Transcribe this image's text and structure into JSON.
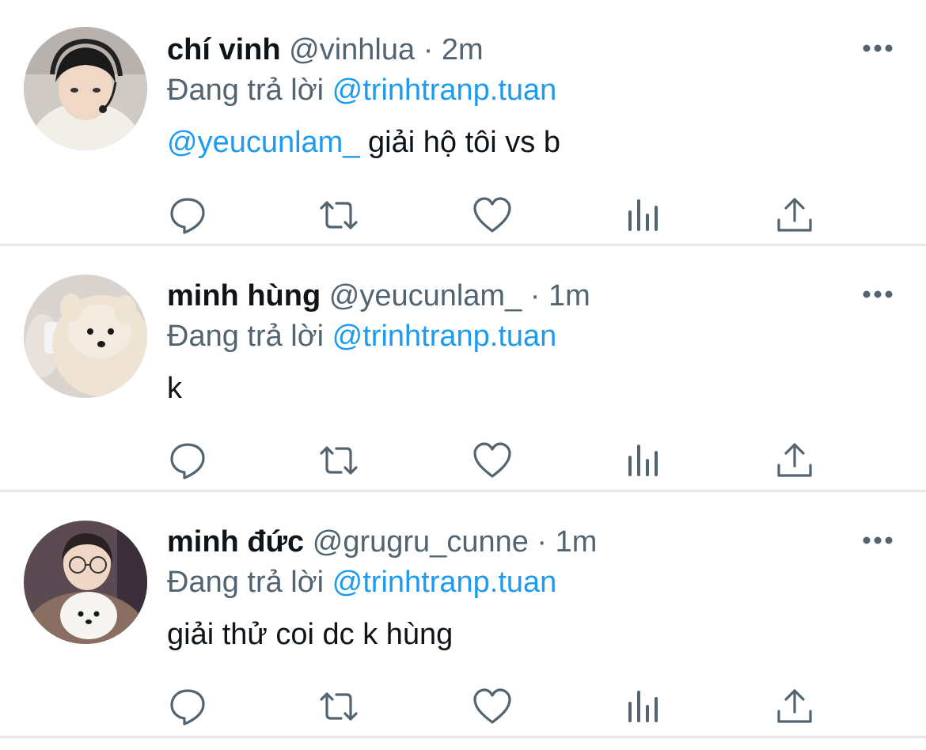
{
  "tweets": [
    {
      "name": "chí vinh",
      "handle": "@vinhlua",
      "separator": "·",
      "time": "2m",
      "reply_prefix": "Đang trả lời",
      "reply_to": "@trinhtranp.tuan",
      "body_mention": "@yeucunlam_",
      "body_text": " giải hộ tôi vs b",
      "avatar_icon": "avatar-person-headset"
    },
    {
      "name": "minh hùng",
      "handle": "@yeucunlam_",
      "separator": "·",
      "time": "1m",
      "reply_prefix": "Đang trả lời",
      "reply_to": "@trinhtranp.tuan",
      "body_mention": "",
      "body_text": "k",
      "avatar_icon": "avatar-pomeranian"
    },
    {
      "name": "minh đức",
      "handle": "@grugru_cunne",
      "separator": "·",
      "time": "1m",
      "reply_prefix": "Đang trả lời",
      "reply_to": "@trinhtranp.tuan",
      "body_mention": "",
      "body_text": "giải thử coi dc k hùng",
      "avatar_icon": "avatar-person-with-dog"
    }
  ],
  "actions": [
    "reply-icon",
    "retweet-icon",
    "like-icon",
    "analytics-icon",
    "share-icon"
  ],
  "colors": {
    "accent": "#1d9bf0",
    "secondary_text": "#536471",
    "icon": "#536471",
    "divider": "#e6e9eb"
  }
}
